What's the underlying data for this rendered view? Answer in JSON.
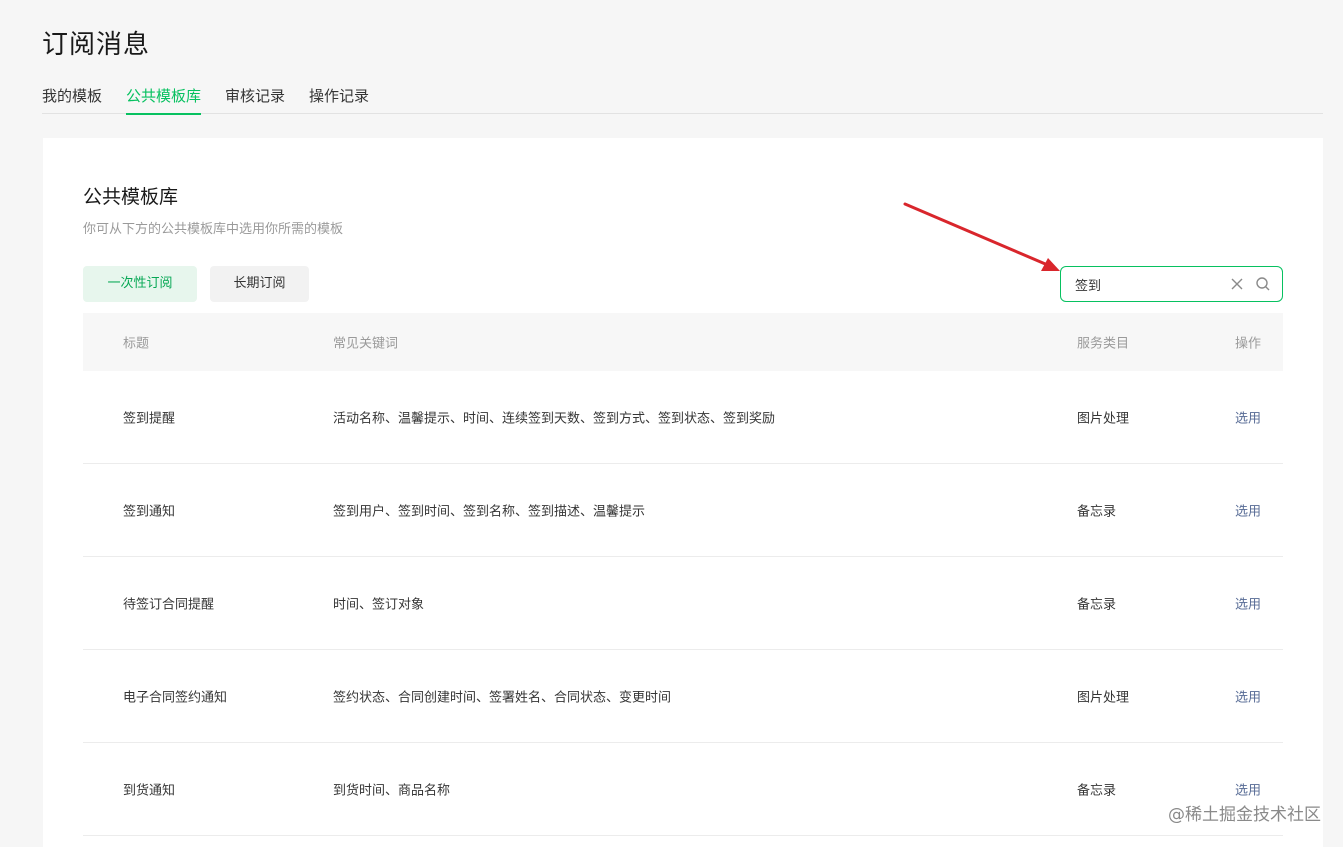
{
  "page_title": "订阅消息",
  "tabs": [
    {
      "label": "我的模板",
      "active": false
    },
    {
      "label": "公共模板库",
      "active": true
    },
    {
      "label": "审核记录",
      "active": false
    },
    {
      "label": "操作记录",
      "active": false
    }
  ],
  "card": {
    "title": "公共模板库",
    "description": "你可从下方的公共模板库中选用你所需的模板"
  },
  "filters": {
    "once_label": "一次性订阅",
    "long_label": "长期订阅"
  },
  "search": {
    "value": "签到"
  },
  "table": {
    "headers": {
      "title": "标题",
      "keywords": "常见关键词",
      "category": "服务类目",
      "action": "操作"
    },
    "rows": [
      {
        "title": "签到提醒",
        "keywords": "活动名称、温馨提示、时间、连续签到天数、签到方式、签到状态、签到奖励",
        "category": "图片处理",
        "action": "选用"
      },
      {
        "title": "签到通知",
        "keywords": "签到用户、签到时间、签到名称、签到描述、温馨提示",
        "category": "备忘录",
        "action": "选用"
      },
      {
        "title": "待签订合同提醒",
        "keywords": "时间、签订对象",
        "category": "备忘录",
        "action": "选用"
      },
      {
        "title": "电子合同签约通知",
        "keywords": "签约状态、合同创建时间、签署姓名、合同状态、变更时间",
        "category": "图片处理",
        "action": "选用"
      },
      {
        "title": "到货通知",
        "keywords": "到货时间、商品名称",
        "category": "备忘录",
        "action": "选用"
      }
    ]
  },
  "colors": {
    "accent": "#07c160",
    "link": "#576b95",
    "annotation_arrow": "#d9262c"
  },
  "watermark": "@稀土掘金技术社区"
}
